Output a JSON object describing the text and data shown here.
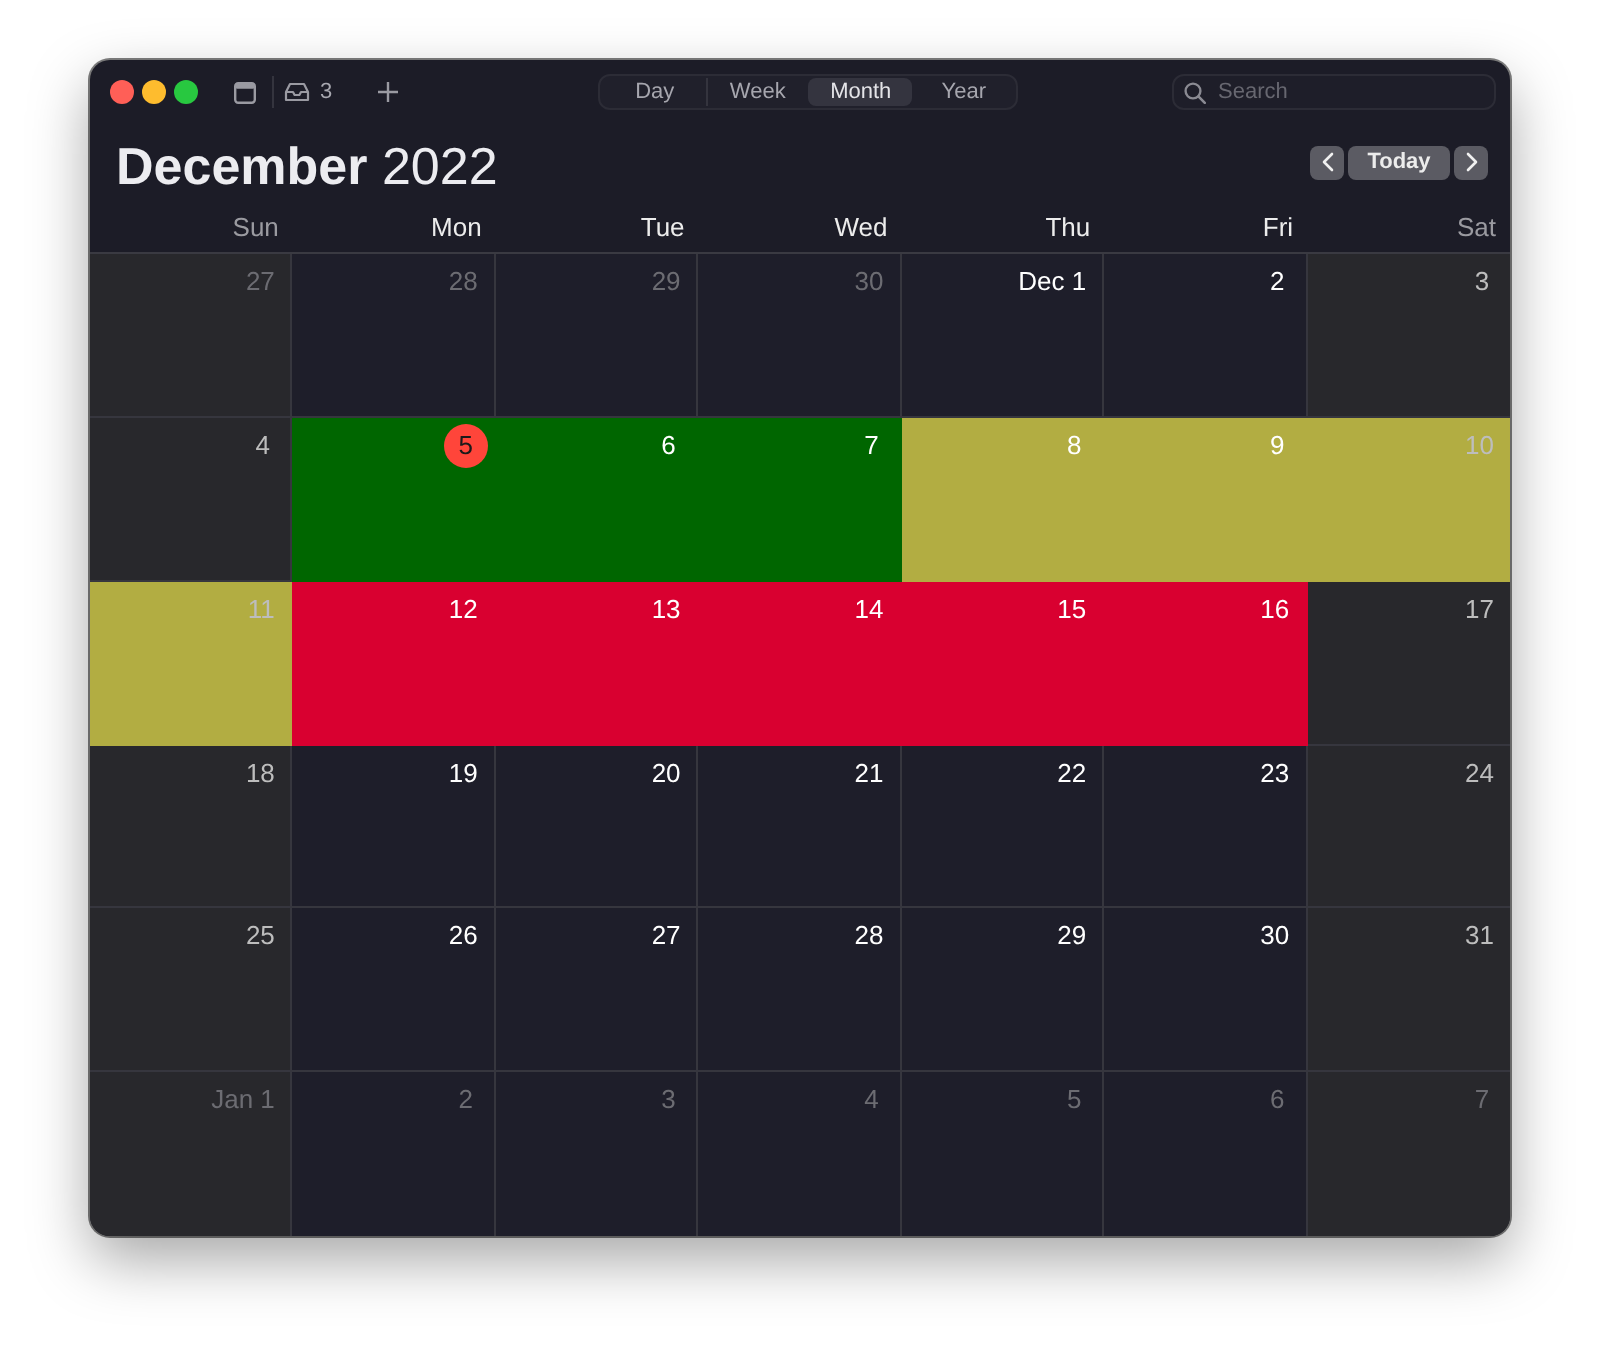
{
  "toolbar": {
    "inbox_count": "3",
    "views": [
      {
        "label": "Day",
        "selected": false
      },
      {
        "label": "Week",
        "selected": false
      },
      {
        "label": "Month",
        "selected": true
      },
      {
        "label": "Year",
        "selected": false
      }
    ],
    "search": {
      "placeholder": "Search"
    }
  },
  "header": {
    "title": "**December** 2022",
    "today_button": "Today"
  },
  "weekdays": [
    {
      "label": "Sun",
      "weekend": true
    },
    {
      "label": "Mon",
      "weekend": false
    },
    {
      "label": "Tue",
      "weekend": false
    },
    {
      "label": "Wed",
      "weekend": false
    },
    {
      "label": "Thu",
      "weekend": false
    },
    {
      "label": "Fri",
      "weekend": false
    },
    {
      "label": "Sat",
      "weekend": true
    }
  ],
  "weeks": [
    {
      "days": [
        {
          "label": "27",
          "in_month": false,
          "today": false
        },
        {
          "label": "28",
          "in_month": false,
          "today": false
        },
        {
          "label": "29",
          "in_month": false,
          "today": false
        },
        {
          "label": "30",
          "in_month": false,
          "today": false
        },
        {
          "label": "Dec 1",
          "in_month": true,
          "today": false
        },
        {
          "label": "2",
          "in_month": true,
          "today": false
        },
        {
          "label": "3",
          "in_month": true,
          "today": false
        }
      ]
    },
    {
      "days": [
        {
          "label": "4",
          "in_month": true,
          "today": false
        },
        {
          "label": "5",
          "in_month": true,
          "today": true,
          "color": "#006600"
        },
        {
          "label": "6",
          "in_month": true,
          "today": false,
          "color": "#006600"
        },
        {
          "label": "7",
          "in_month": true,
          "today": false,
          "color": "#006600"
        },
        {
          "label": "8",
          "in_month": true,
          "today": false,
          "color": "#b2ad42"
        },
        {
          "label": "9",
          "in_month": true,
          "today": false,
          "color": "#b2ad42"
        },
        {
          "label": "10",
          "in_month": true,
          "today": false,
          "color": "#b2ad42"
        }
      ]
    },
    {
      "days": [
        {
          "label": "11",
          "in_month": true,
          "today": false,
          "color": "#b2ad42"
        },
        {
          "label": "12",
          "in_month": true,
          "today": false,
          "color": "#d90030"
        },
        {
          "label": "13",
          "in_month": true,
          "today": false,
          "color": "#d90030"
        },
        {
          "label": "14",
          "in_month": true,
          "today": false,
          "color": "#d90030"
        },
        {
          "label": "15",
          "in_month": true,
          "today": false,
          "color": "#d90030"
        },
        {
          "label": "16",
          "in_month": true,
          "today": false,
          "color": "#d90030"
        },
        {
          "label": "17",
          "in_month": true,
          "today": false
        }
      ]
    },
    {
      "days": [
        {
          "label": "18",
          "in_month": true,
          "today": false
        },
        {
          "label": "19",
          "in_month": true,
          "today": false
        },
        {
          "label": "20",
          "in_month": true,
          "today": false
        },
        {
          "label": "21",
          "in_month": true,
          "today": false
        },
        {
          "label": "22",
          "in_month": true,
          "today": false
        },
        {
          "label": "23",
          "in_month": true,
          "today": false
        },
        {
          "label": "24",
          "in_month": true,
          "today": false
        }
      ]
    },
    {
      "days": [
        {
          "label": "25",
          "in_month": true,
          "today": false
        },
        {
          "label": "26",
          "in_month": true,
          "today": false
        },
        {
          "label": "27",
          "in_month": true,
          "today": false
        },
        {
          "label": "28",
          "in_month": true,
          "today": false
        },
        {
          "label": "29",
          "in_month": true,
          "today": false
        },
        {
          "label": "30",
          "in_month": true,
          "today": false
        },
        {
          "label": "31",
          "in_month": true,
          "today": false
        }
      ]
    },
    {
      "days": [
        {
          "label": "Jan 1",
          "in_month": false,
          "today": false
        },
        {
          "label": "2",
          "in_month": false,
          "today": false
        },
        {
          "label": "3",
          "in_month": false,
          "today": false
        },
        {
          "label": "4",
          "in_month": false,
          "today": false
        },
        {
          "label": "5",
          "in_month": false,
          "today": false
        },
        {
          "label": "6",
          "in_month": false,
          "today": false
        },
        {
          "label": "7",
          "in_month": false,
          "today": false
        }
      ]
    }
  ]
}
